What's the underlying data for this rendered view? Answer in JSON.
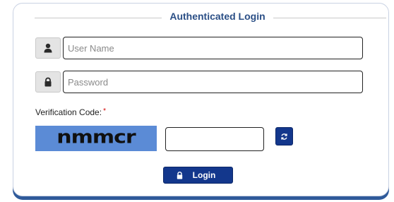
{
  "form": {
    "title": "Authenticated Login",
    "username": {
      "placeholder": "User Name",
      "value": "",
      "icon": "user-icon"
    },
    "password": {
      "placeholder": "Password",
      "value": "",
      "icon": "lock-icon"
    },
    "verification": {
      "label": "Verification Code:",
      "required_mark": "*",
      "captcha_text": "nmmcr",
      "input_value": "",
      "refresh_icon": "refresh-icon"
    },
    "login_button": {
      "label": "Login",
      "icon": "lock-icon"
    }
  },
  "colors": {
    "accent": "#13378c",
    "title": "#2b4f86",
    "captcha_bg": "#5b8bd6",
    "required": "#d40000"
  }
}
